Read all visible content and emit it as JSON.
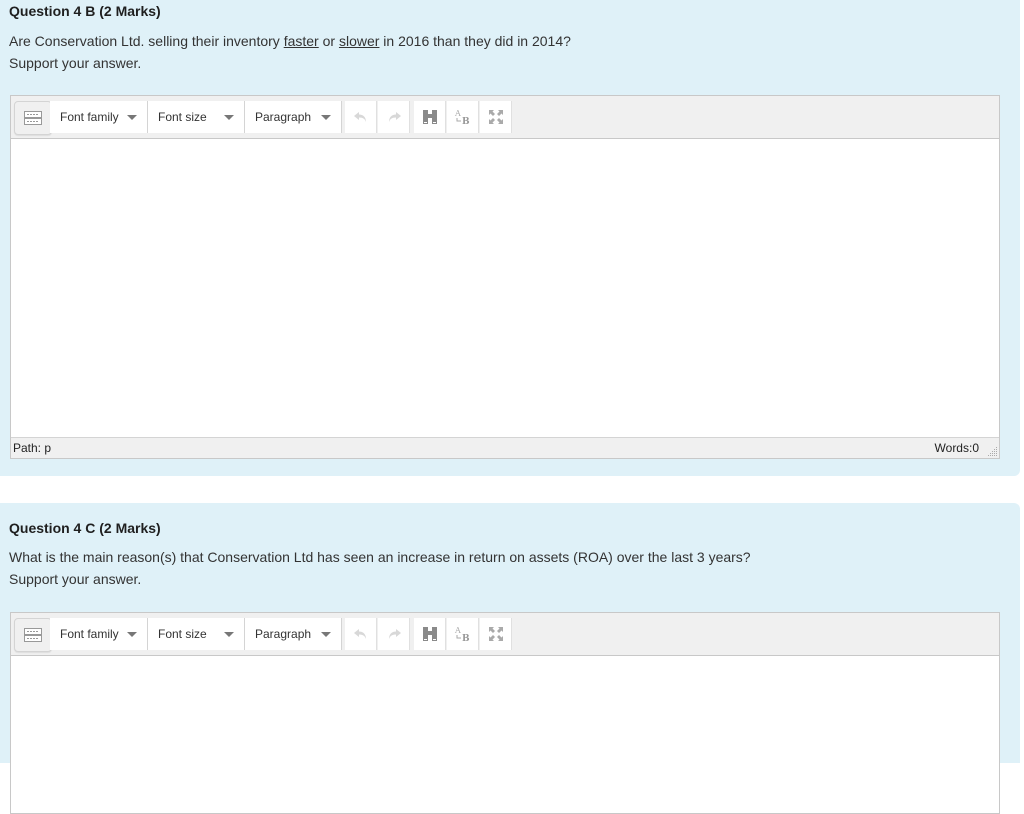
{
  "questions": [
    {
      "title": "Question 4 B (2 Marks)",
      "text_parts": {
        "pre": "Are Conservation Ltd. selling their inventory ",
        "u1": "faster",
        "mid": " or ",
        "u2": "slower",
        "post": " in 2016 than they did in 2014?"
      },
      "support": "Support your answer.",
      "editor": {
        "font_family": "Font family",
        "font_size": "Font size",
        "paragraph": "Paragraph",
        "content": "",
        "path": "Path: p",
        "words": "Words:0"
      }
    },
    {
      "title": "Question 4 C (2 Marks)",
      "text": "What is the main reason(s) that Conservation Ltd has seen an increase in return on assets (ROA) over the last 3 years?",
      "support": "Support your answer.",
      "editor": {
        "font_family": "Font family",
        "font_size": "Font size",
        "paragraph": "Paragraph",
        "content": ""
      }
    }
  ],
  "icons": {
    "keyboard": "keyboard-icon",
    "undo": "undo-icon",
    "redo": "redo-icon",
    "find": "binoculars-icon",
    "replace": "find-replace-icon",
    "fullscreen": "fullscreen-icon"
  },
  "colors": {
    "question_bg": "#dff1f8",
    "toolbar_bg": "#f0f0f0"
  }
}
